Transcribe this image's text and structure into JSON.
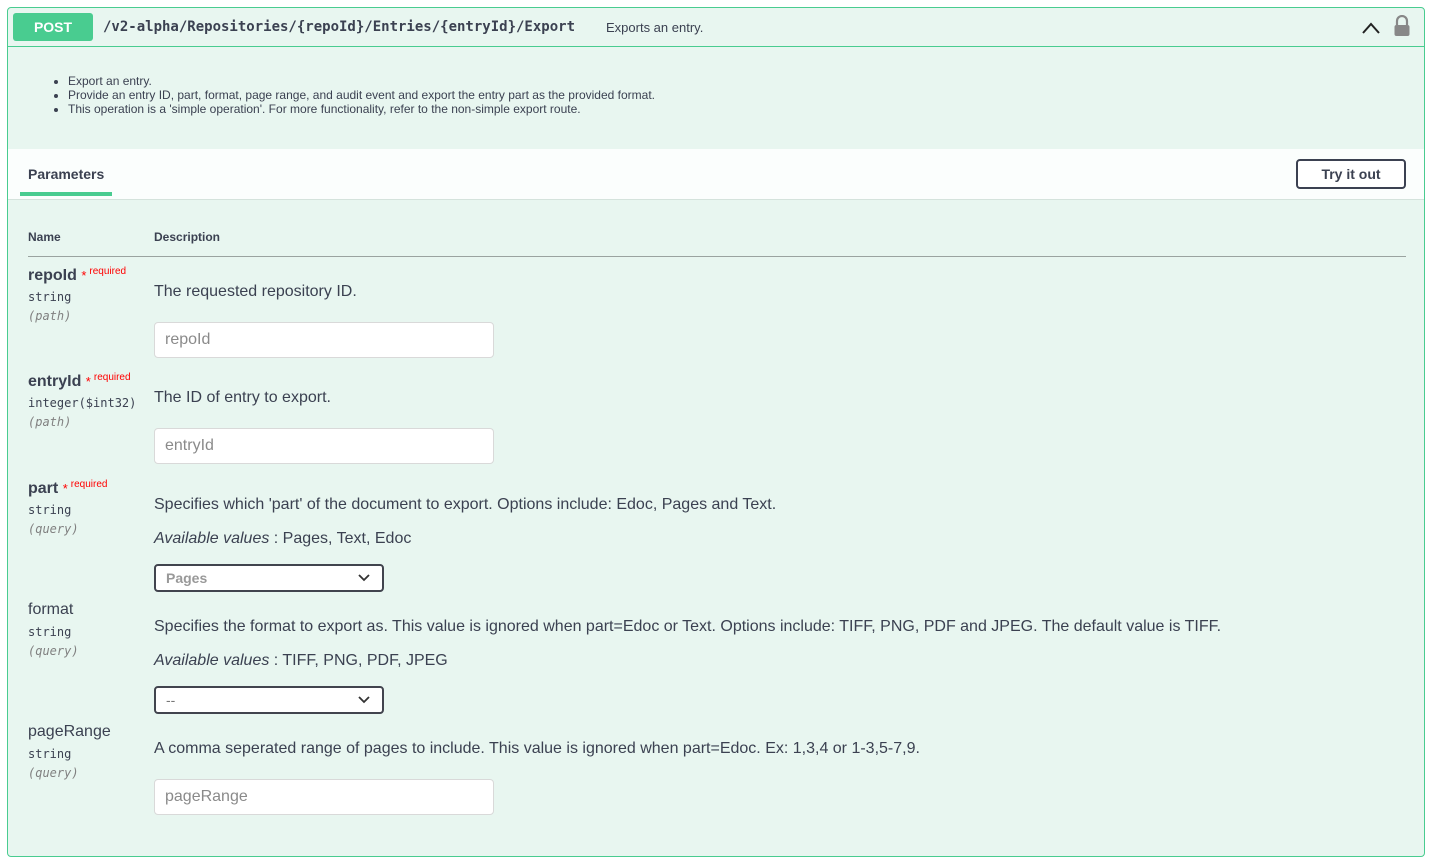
{
  "operation": {
    "method": "POST",
    "path": "/v2-alpha/Repositories/{repoId}/Entries/{entryId}/Export",
    "summary": "Exports an entry."
  },
  "description": [
    "Export an entry.",
    "Provide an entry ID, part, format, page range, and audit event and export the entry part as the provided format.",
    "This operation is a 'simple operation'. For more functionality, refer to the non-simple export route."
  ],
  "parameters_section": {
    "tab_label": "Parameters",
    "try_button": "Try it out",
    "col_name": "Name",
    "col_description": "Description"
  },
  "params": {
    "repoId": {
      "name": "repoId",
      "star": "*",
      "required": "required",
      "type": "string",
      "in": "(path)",
      "description": "The requested repository ID.",
      "placeholder": "repoId"
    },
    "entryId": {
      "name": "entryId",
      "star": "*",
      "required": "required",
      "type": "integer($int32)",
      "in": "(path)",
      "description": "The ID of entry to export.",
      "placeholder": "entryId"
    },
    "part": {
      "name": "part",
      "star": "*",
      "required": "required",
      "type": "string",
      "in": "(query)",
      "description": "Specifies which 'part' of the document to export. Options include: Edoc, Pages and Text.",
      "available_label": "Available values",
      "available_values": " : Pages, Text, Edoc",
      "selected": "Pages"
    },
    "format": {
      "name": "format",
      "type": "string",
      "in": "(query)",
      "description": "Specifies the format to export as. This value is ignored when part=Edoc or Text. Options include: TIFF, PNG, PDF and JPEG. The default value is TIFF.",
      "available_label": "Available values",
      "available_values": " : TIFF, PNG, PDF, JPEG",
      "selected": "--"
    },
    "pageRange": {
      "name": "pageRange",
      "type": "string",
      "in": "(query)",
      "description": "A comma seperated range of pages to include. This value is ignored when part=Edoc. Ex: 1,3,4 or 1-3,5-7,9.",
      "placeholder": "pageRange"
    }
  },
  "colors": {
    "post_green": "#49cc90",
    "panel_bg": "#e8f6f0",
    "required_red": "#ff0000",
    "text": "#3b4151"
  }
}
